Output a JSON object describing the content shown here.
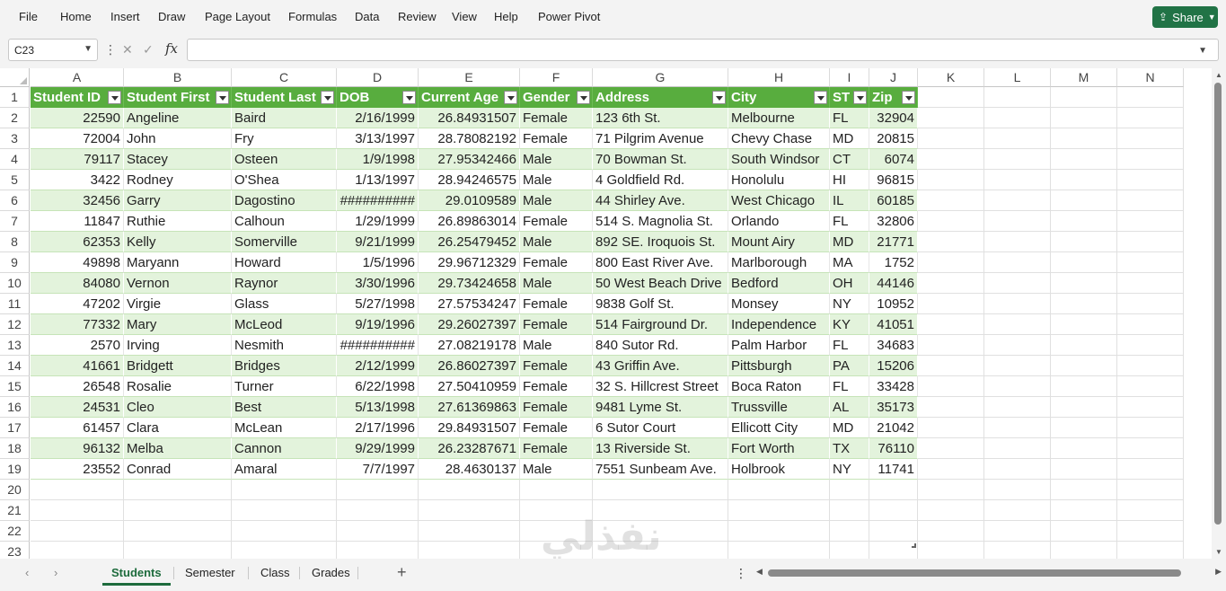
{
  "menu": {
    "items": [
      "File",
      "Home",
      "Insert",
      "Draw",
      "Page Layout",
      "Formulas",
      "Data",
      "Review",
      "View",
      "Help",
      "Power Pivot"
    ],
    "share_label": "Share"
  },
  "formula_bar": {
    "name_box": "C23",
    "fx_label": "fx",
    "formula": ""
  },
  "columns": [
    "A",
    "B",
    "C",
    "D",
    "E",
    "F",
    "G",
    "H",
    "I",
    "J",
    "K",
    "L",
    "M",
    "N"
  ],
  "rows": [
    "1",
    "2",
    "3",
    "4",
    "5",
    "6",
    "7",
    "8",
    "9",
    "10",
    "11",
    "12",
    "13",
    "14",
    "15",
    "16",
    "17",
    "18",
    "19",
    "20",
    "21",
    "22",
    "23"
  ],
  "table": {
    "headers": [
      "Student ID",
      "Student First",
      "Student Last",
      "DOB",
      "Current Age",
      "Gender",
      "Address",
      "City",
      "ST",
      "Zip"
    ],
    "rows": [
      [
        "22590",
        "Angeline",
        "Baird",
        "2/16/1999",
        "26.84931507",
        "Female",
        "123 6th St.",
        "Melbourne",
        "FL",
        "32904"
      ],
      [
        "72004",
        "John",
        "Fry",
        "3/13/1997",
        "28.78082192",
        "Female",
        "71 Pilgrim Avenue",
        "Chevy Chase",
        "MD",
        "20815"
      ],
      [
        "79117",
        "Stacey",
        "Osteen",
        "1/9/1998",
        "27.95342466",
        "Male",
        "70 Bowman St.",
        "South Windsor",
        "CT",
        "6074"
      ],
      [
        "3422",
        "Rodney",
        "O'Shea",
        "1/13/1997",
        "28.94246575",
        "Male",
        "4 Goldfield Rd.",
        "Honolulu",
        "HI",
        "96815"
      ],
      [
        "32456",
        "Garry",
        "Dagostino",
        "##########",
        "29.0109589",
        "Male",
        "44 Shirley Ave.",
        "West Chicago",
        "IL",
        "60185"
      ],
      [
        "11847",
        "Ruthie",
        "Calhoun",
        "1/29/1999",
        "26.89863014",
        "Female",
        "514 S. Magnolia St.",
        "Orlando",
        "FL",
        "32806"
      ],
      [
        "62353",
        "Kelly",
        "Somerville",
        "9/21/1999",
        "26.25479452",
        "Male",
        "892 SE. Iroquois St.",
        "Mount Airy",
        "MD",
        "21771"
      ],
      [
        "49898",
        "Maryann",
        "Howard",
        "1/5/1996",
        "29.96712329",
        "Female",
        "800 East River Ave.",
        "Marlborough",
        "MA",
        "1752"
      ],
      [
        "84080",
        "Vernon",
        "Raynor",
        "3/30/1996",
        "29.73424658",
        "Male",
        "50 West Beach Drive",
        "Bedford",
        "OH",
        "44146"
      ],
      [
        "47202",
        "Virgie",
        "Glass",
        "5/27/1998",
        "27.57534247",
        "Female",
        "9838 Golf St.",
        "Monsey",
        "NY",
        "10952"
      ],
      [
        "77332",
        "Mary",
        "McLeod",
        "9/19/1996",
        "29.26027397",
        "Female",
        "514 Fairground Dr.",
        "Independence",
        "KY",
        "41051"
      ],
      [
        "2570",
        "Irving",
        "Nesmith",
        "##########",
        "27.08219178",
        "Male",
        "840 Sutor Rd.",
        "Palm Harbor",
        "FL",
        "34683"
      ],
      [
        "41661",
        "Bridgett",
        "Bridges",
        "2/12/1999",
        "26.86027397",
        "Female",
        "43 Griffin Ave.",
        "Pittsburgh",
        "PA",
        "15206"
      ],
      [
        "26548",
        "Rosalie",
        "Turner",
        "6/22/1998",
        "27.50410959",
        "Female",
        "32 S. Hillcrest Street",
        "Boca Raton",
        "FL",
        "33428"
      ],
      [
        "24531",
        "Cleo",
        "Best",
        "5/13/1998",
        "27.61369863",
        "Female",
        "9481 Lyme St.",
        "Trussville",
        "AL",
        "35173"
      ],
      [
        "61457",
        "Clara",
        "McLean",
        "2/17/1996",
        "29.84931507",
        "Female",
        "6 Sutor Court",
        "Ellicott City",
        "MD",
        "21042"
      ],
      [
        "96132",
        "Melba",
        "Cannon",
        "9/29/1999",
        "26.23287671",
        "Female",
        "13 Riverside St.",
        "Fort Worth",
        "TX",
        "76110"
      ],
      [
        "23552",
        "Conrad",
        "Amaral",
        "7/7/1997",
        "28.4630137",
        "Male",
        "7551 Sunbeam Ave.",
        "Holbrook",
        "NY",
        "11741"
      ]
    ]
  },
  "sheet_tabs": {
    "tabs": [
      "Students",
      "Semester",
      "Class",
      "Grades"
    ],
    "active": "Students"
  },
  "watermark": {
    "arabic": "نفذلي",
    "latin": "nafezly.com"
  },
  "colors": {
    "header_fill": "#58ad3e",
    "band_fill": "#e3f3dc",
    "share_button": "#217346"
  }
}
